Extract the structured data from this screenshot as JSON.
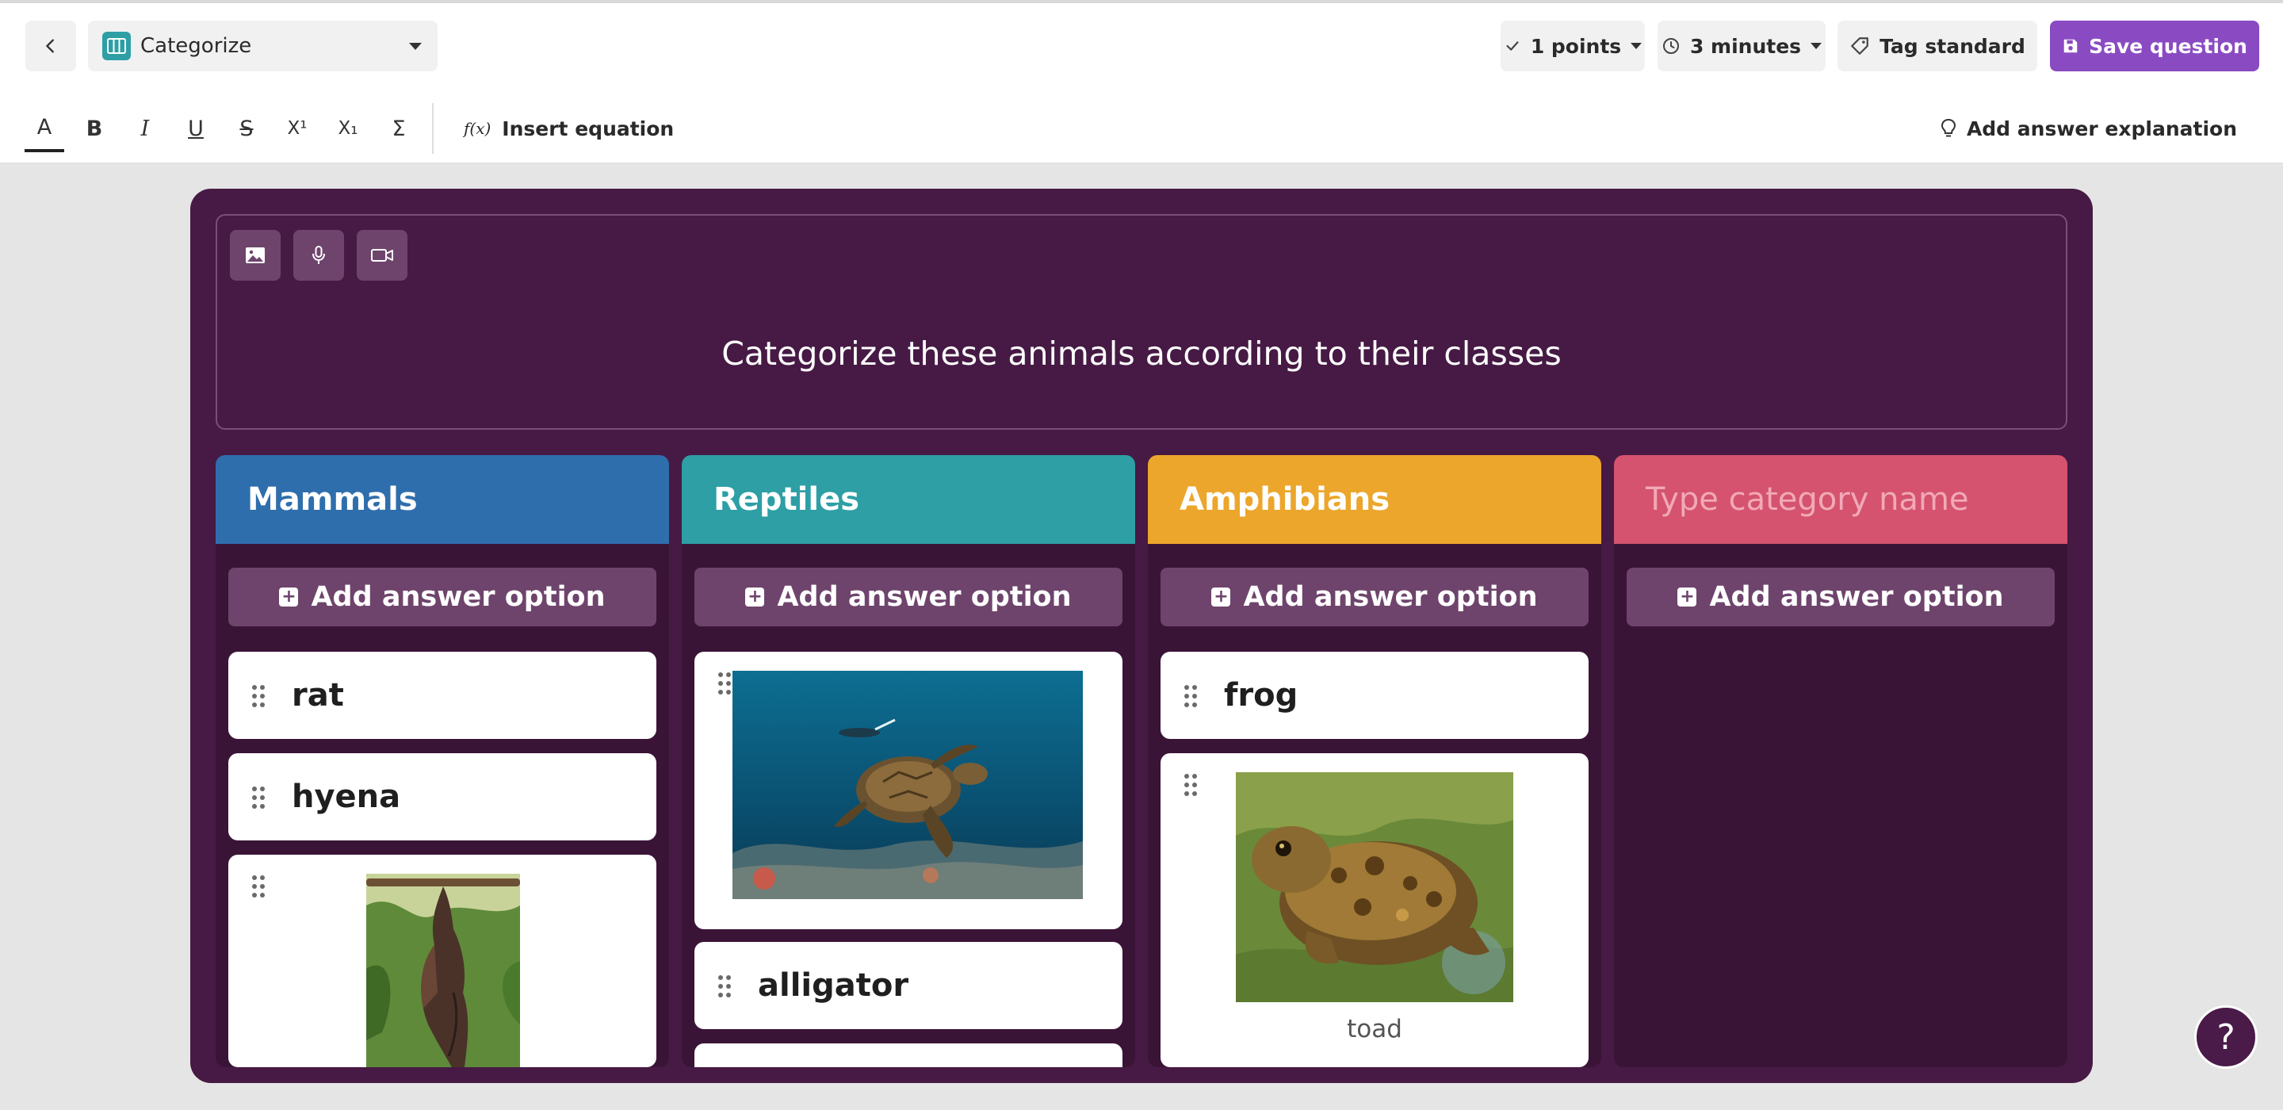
{
  "header": {
    "question_type": "Categorize",
    "points": "1 points",
    "time": "3 minutes",
    "tag_label": "Tag standard",
    "save_label": "Save question"
  },
  "format_toolbar": {
    "text_color": "A",
    "bold": "B",
    "italic": "I",
    "underline": "U",
    "strike": "S",
    "superscript": "X¹",
    "subscript": "X₁",
    "sigma": "Σ",
    "eq_prefix": "f(x)",
    "insert_equation": "Insert equation",
    "add_explanation": "Add answer explanation"
  },
  "question": {
    "text": "Categorize these animals according to their classes"
  },
  "columns": [
    {
      "name": "Mammals",
      "color": "#2f6eac",
      "add_label": "Add answer option",
      "options": [
        "rat",
        "hyena"
      ]
    },
    {
      "name": "Reptiles",
      "color": "#2d9fa5",
      "add_label": "Add answer option",
      "options": [
        "alligator"
      ]
    },
    {
      "name": "Amphibians",
      "color": "#eca62c",
      "add_label": "Add answer option",
      "options": [
        "frog"
      ],
      "image_caption": "toad"
    },
    {
      "name": "",
      "placeholder": "Type category name",
      "color": "#d5536e",
      "add_label": "Add answer option",
      "options": []
    }
  ],
  "colors": {
    "card_bg": "#461a44",
    "column_bg": "#3a1437",
    "accent": "#8a4bc2"
  }
}
